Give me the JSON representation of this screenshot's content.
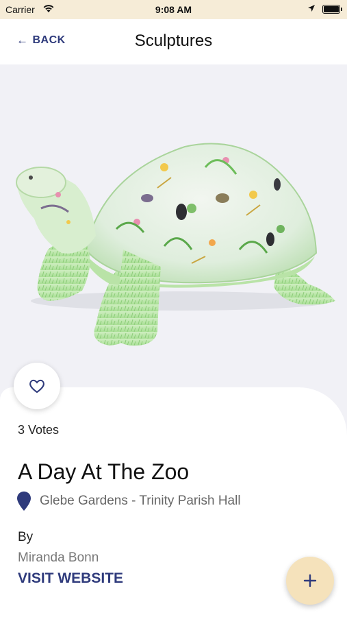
{
  "status_bar": {
    "carrier": "Carrier",
    "time": "9:08 AM"
  },
  "nav": {
    "back_label": "BACK",
    "title": "Sculptures"
  },
  "sculpture": {
    "image_icon": "turtle-sculpture-image",
    "votes": "3 Votes",
    "name": "A Day At The Zoo",
    "location": "Glebe Gardens - Trinity Parish Hall",
    "by_label": "By",
    "artist": "Miranda Bonn",
    "visit_label": "VISIT WEBSITE"
  },
  "icons": {
    "favorite": "heart-outline-icon",
    "location": "map-pin-icon",
    "add": "plus-icon"
  },
  "colors": {
    "accent": "#2f3b7c",
    "status_bar_bg": "#f6ecd7",
    "fab_bg": "#f5e2bb",
    "hero_bg": "#f1f1f6"
  }
}
